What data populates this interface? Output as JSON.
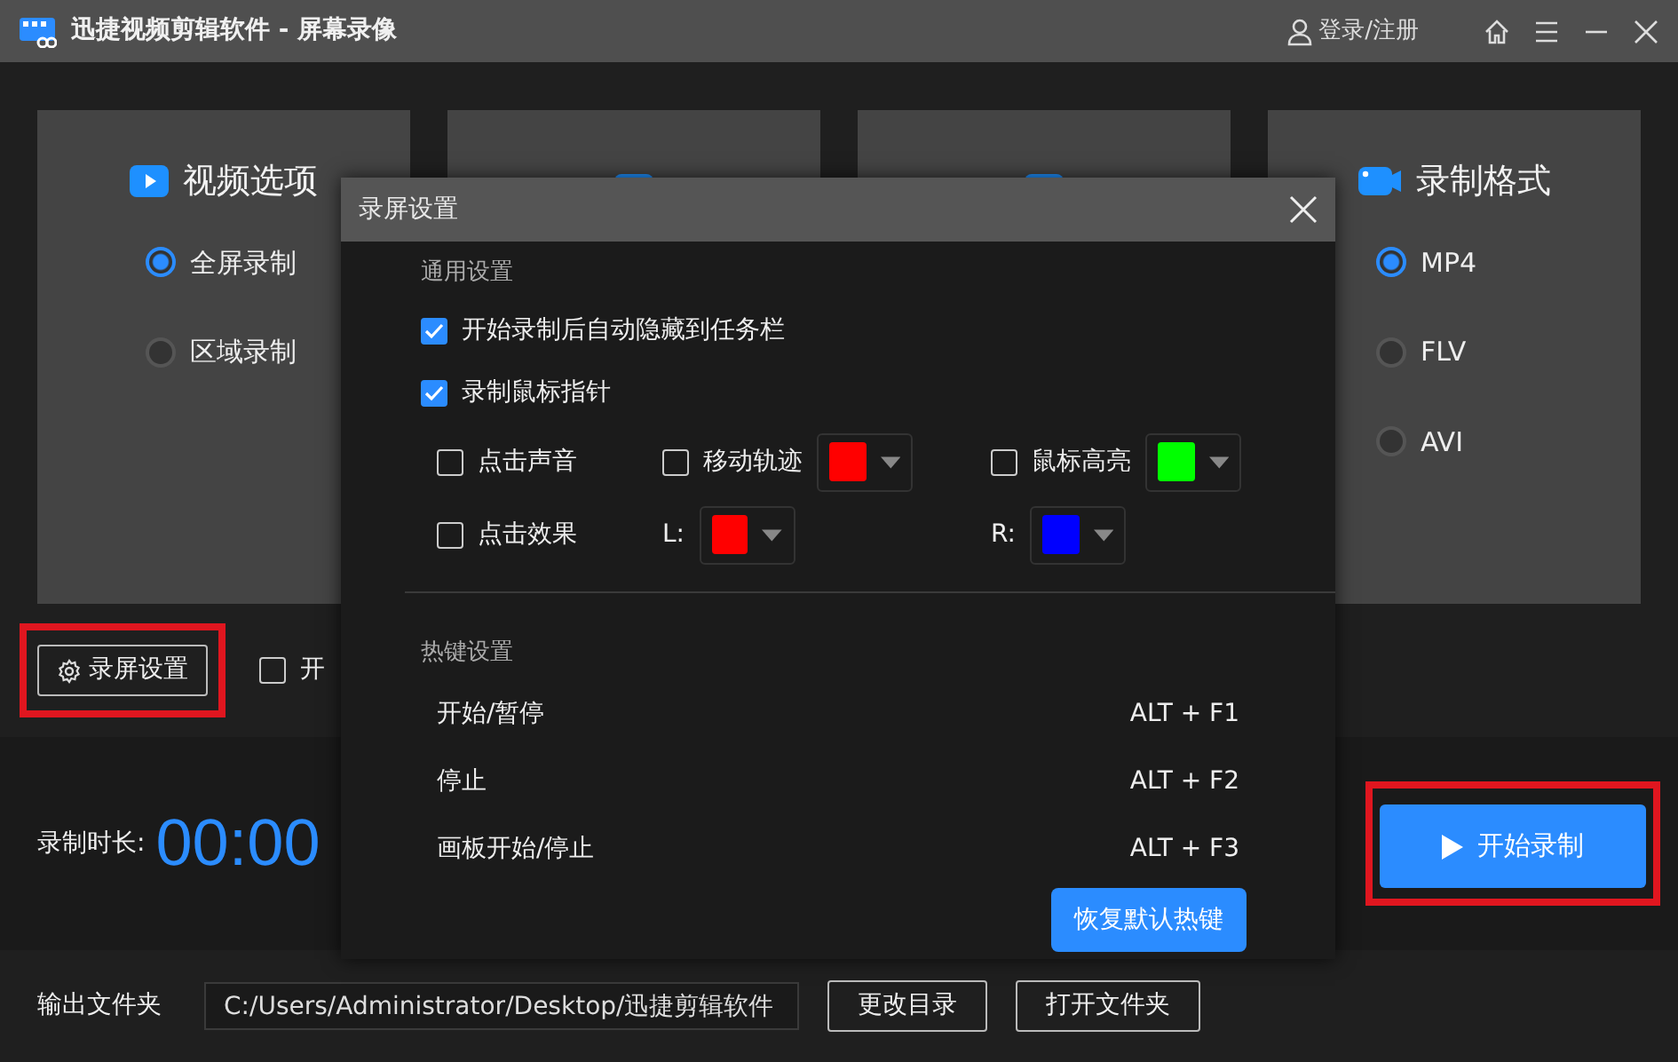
{
  "window": {
    "title": "迅捷视频剪辑软件 - 屏幕录像",
    "login": "登录/注册"
  },
  "option_cards": [
    {
      "kind": "options",
      "title": "视频选项",
      "options": [
        {
          "label": "全屏录制",
          "selected": true
        },
        {
          "label": "区域录制",
          "selected": false
        }
      ]
    },
    {
      "kind": "covered"
    },
    {
      "kind": "covered"
    },
    {
      "kind": "options",
      "title": "录制格式",
      "options": [
        {
          "label": "MP4",
          "selected": true
        },
        {
          "label": "FLV",
          "selected": false
        },
        {
          "label": "AVI",
          "selected": false
        }
      ]
    }
  ],
  "settings_button": {
    "label": "录屏设置",
    "annotated": true
  },
  "extra_checkbox": {
    "label": "开",
    "checked": false
  },
  "duration": {
    "label": "录制时长:",
    "value": "00:00"
  },
  "start_button": {
    "label": "开始录制",
    "annotated": true
  },
  "output": {
    "label": "输出文件夹",
    "path": "C:/Users/Administrator/Desktop/迅捷剪辑软件",
    "buttons": [
      "更改目录",
      "打开文件夹"
    ]
  },
  "dialog": {
    "title": "录屏设置",
    "general_heading": "通用设置",
    "options": [
      {
        "label": "开始录制后自动隐藏到任务栏",
        "checked": true
      },
      {
        "label": "录制鼠标指针",
        "checked": true
      }
    ],
    "mouse_options": [
      {
        "kind": "checkbox",
        "label": "点击声音",
        "checked": false
      },
      {
        "kind": "checkbox",
        "label": "移动轨迹",
        "checked": false,
        "color": "#ff0000"
      },
      {
        "kind": "checkbox",
        "label": "鼠标高亮",
        "checked": false,
        "color": "#00ff00"
      },
      {
        "kind": "checkbox",
        "label": "点击效果",
        "checked": false
      },
      {
        "kind": "color",
        "label": "L:",
        "color": "#ff0000"
      },
      {
        "kind": "color",
        "label": "R:",
        "color": "#0000ff"
      }
    ],
    "hotkey_heading": "热键设置",
    "hotkeys": [
      {
        "action": "开始/暂停",
        "keys": "ALT + F1"
      },
      {
        "action": "停止",
        "keys": "ALT + F2"
      },
      {
        "action": "画板开始/停止",
        "keys": "ALT + F3"
      }
    ],
    "reset_button": "恢复默认热键"
  }
}
